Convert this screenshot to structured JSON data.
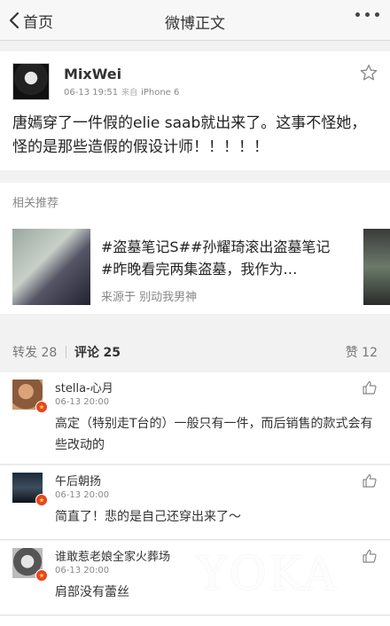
{
  "nav": {
    "back_label": "首页",
    "title": "微博正文",
    "more_icon": "more-dots-icon"
  },
  "post": {
    "author": "MixWei",
    "time": "06-13 19:51",
    "source_label": "来自",
    "source": "iPhone 6",
    "text": "唐嫣穿了一件假的elie saab就出来了。这事不怪她，怪的是那些造假的假设计师！！！！！"
  },
  "related": {
    "title": "相关推荐",
    "item_text": "#盗墓笔记S##孙耀琦滚出盗墓笔记#昨晚看完两集盗墓，我作为…",
    "item_source": "来源于 别动我男神"
  },
  "tabs": {
    "repost_label": "转发",
    "repost_count": "28",
    "comment_label": "评论",
    "comment_count": "25",
    "like_label": "赞",
    "like_count": "12"
  },
  "comments": [
    {
      "name": "stella-心月",
      "time": "06-13 20:00",
      "text": "高定（特别走T台的）一般只有一件，而后销售的款式会有些改动的"
    },
    {
      "name": "午后朝扬",
      "time": "06-13 20:00",
      "text": "简直了！悲的是自己还穿出来了～"
    },
    {
      "name": "谁敢惹老娘全家火葬场",
      "time": "06-13 20:00",
      "text": "肩部没有蕾丝"
    }
  ],
  "watermark": "YOKA",
  "colors": {
    "accent_badge": "#e8451e",
    "background": "#f2f2f2"
  }
}
